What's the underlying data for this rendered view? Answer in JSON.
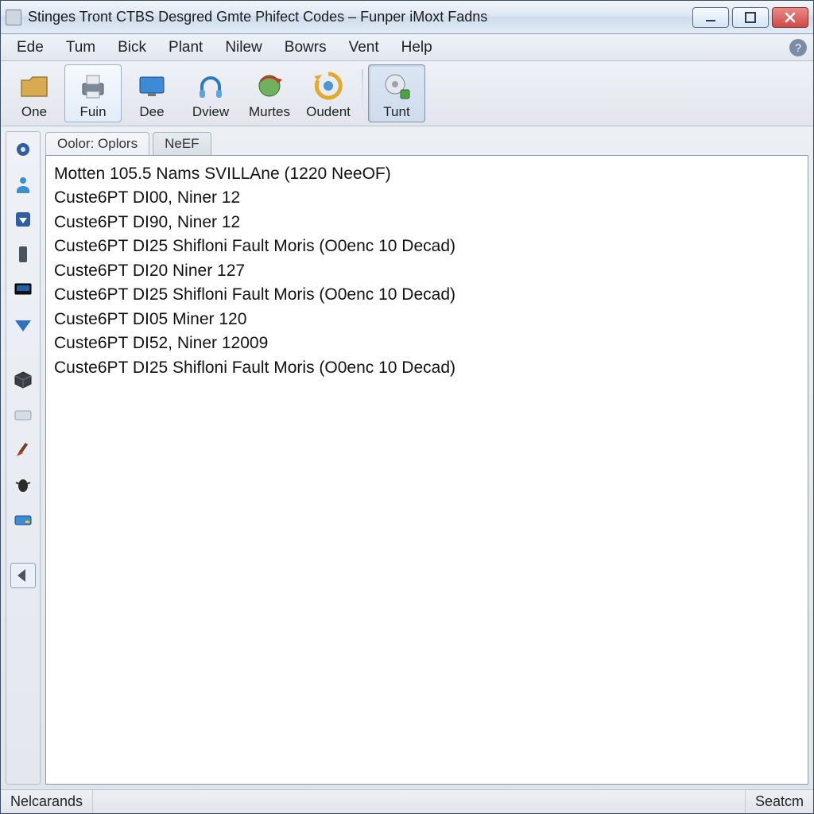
{
  "window": {
    "title": "Stinges Tront CTBS Desgred Gmte Phifect Codes – Funper iMoxt Fadns"
  },
  "menubar": {
    "items": [
      "Ede",
      "Tum",
      "Bick",
      "Plant",
      "Nilew",
      "Bowrs",
      "Vent",
      "Help"
    ]
  },
  "toolbar": {
    "buttons": [
      {
        "label": "One",
        "icon": "folder-icon"
      },
      {
        "label": "Fuin",
        "icon": "printer-icon"
      },
      {
        "label": "Dee",
        "icon": "monitor-icon"
      },
      {
        "label": "Dview",
        "icon": "headphones-icon"
      },
      {
        "label": "Murtes",
        "icon": "globe-refresh-icon"
      },
      {
        "label": "Oudent",
        "icon": "recycle-icon"
      },
      {
        "label": "Tunt",
        "icon": "disc-gear-icon"
      }
    ],
    "active_index": 1,
    "pressed_index": 6
  },
  "tabs": {
    "items": [
      "Oolor: Oplors",
      "NeEF"
    ],
    "active_index": 0
  },
  "list": {
    "rows": [
      "Motten 105.5 Nams SVILLAne (1220 NeeOF)",
      "Custe6PT DI00, Niner 12",
      "Custe6PT DI90, Niner 12",
      "Custe6PT DI25 Shifloni Fault Moris (O0enc 10 Decad)",
      "Custe6PT DI20 Niner 127",
      "Custe6PT DI25 Shifloni Fault Moris (O0enc 10 Decad)",
      "Custe6PT DI05 Miner 120",
      "Custe6PT DI52, Niner 12009",
      "Custe6PT DI25 Shifloni Fault Moris (O0enc 10 Decad)"
    ]
  },
  "sidebar": {
    "items": [
      "gear-icon",
      "person-icon",
      "box-down-icon",
      "device-icon",
      "screen-icon",
      "arrow-down-icon",
      "cube-icon",
      "keyboard-icon",
      "brush-icon",
      "bug-icon",
      "card-icon",
      "back-icon"
    ]
  },
  "statusbar": {
    "left": "Nelcarands",
    "right": "Seatcm"
  },
  "colors": {
    "accent": "#3d6aa8",
    "close": "#ce4b46"
  }
}
